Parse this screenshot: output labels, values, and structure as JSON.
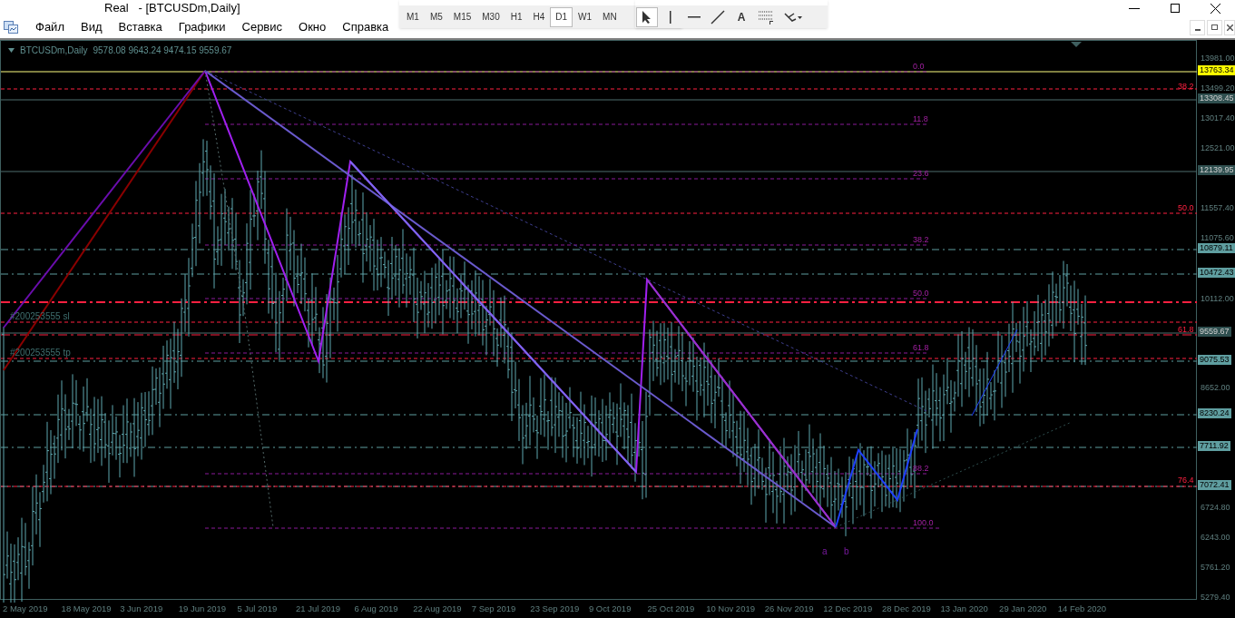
{
  "window": {
    "title": "Real   - [BTCUSDm,Daily]"
  },
  "menu": [
    "Файл",
    "Вид",
    "Вставка",
    "Графики",
    "Сервис",
    "Окно",
    "Справка"
  ],
  "timeframes": [
    {
      "label": "M1",
      "selected": false
    },
    {
      "label": "M5",
      "selected": false
    },
    {
      "label": "M15",
      "selected": false
    },
    {
      "label": "M30",
      "selected": false
    },
    {
      "label": "H1",
      "selected": false
    },
    {
      "label": "H4",
      "selected": false
    },
    {
      "label": "D1",
      "selected": true
    },
    {
      "label": "W1",
      "selected": false
    },
    {
      "label": "MN",
      "selected": false
    }
  ],
  "tools": [
    {
      "kind": "cursor",
      "selected": true
    },
    {
      "kind": "vline",
      "selected": false
    },
    {
      "kind": "hline",
      "selected": false
    },
    {
      "kind": "trend",
      "selected": false
    },
    {
      "kind": "text",
      "label": "A",
      "selected": false
    },
    {
      "kind": "fibo",
      "selected": false
    },
    {
      "kind": "more",
      "selected": false
    }
  ],
  "chart": {
    "symbol": "BTCUSDm,Daily",
    "ohlc": "9578.08 9643.24 9474.15 9559.67",
    "price_ticks": [
      "13981.00",
      "13499.20",
      "13017.40",
      "12521.00",
      "11557.40",
      "11075.60",
      "10112.00",
      "8652.00",
      "6724.80",
      "6243.00",
      "5761.20",
      "5279.40"
    ],
    "price_markers": [
      {
        "label": "13763.34",
        "kind": "bid"
      },
      {
        "label": "13308.45",
        "kind": "level"
      },
      {
        "label": "12139.95",
        "kind": "level"
      },
      {
        "label": "10879.11",
        "kind": "order"
      },
      {
        "label": "10472.43",
        "kind": "order"
      },
      {
        "label": "9559.67",
        "kind": "level"
      },
      {
        "label": "9075.53",
        "kind": "order"
      },
      {
        "label": "8230.24",
        "kind": "order"
      },
      {
        "label": "7711.92",
        "kind": "order"
      },
      {
        "label": "7072.41",
        "kind": "order"
      }
    ],
    "fib_levels": [
      "0.0",
      "11.8",
      "23.6",
      "38.2",
      "50.0",
      "61.8",
      "88.2",
      "100.0"
    ],
    "fib_levels_alt": [
      "38.2",
      "50.0",
      "61.8",
      "76.4"
    ],
    "order_labels": [
      "#200253555 sl",
      "#200253555 tp"
    ],
    "wave_labels": [
      "a",
      "b"
    ],
    "dates": [
      "2 May 2019",
      "18 May 2019",
      "3 Jun 2019",
      "19 Jun 2019",
      "5 Jul 2019",
      "21 Jul 2019",
      "6 Aug 2019",
      "22 Aug 2019",
      "7 Sep 2019",
      "23 Sep 2019",
      "9 Oct 2019",
      "25 Oct 2019",
      "10 Nov 2019",
      "26 Nov 2019",
      "12 Dec 2019",
      "28 Dec 2019",
      "13 Jan 2020",
      "29 Jan 2020",
      "14 Feb 2020"
    ]
  }
}
